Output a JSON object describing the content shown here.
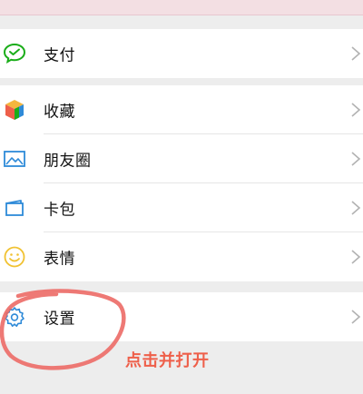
{
  "menu": {
    "pay": {
      "label": "支付",
      "icon": "wechat-pay-icon"
    },
    "favorites": {
      "label": "收藏",
      "icon": "favorites-cube-icon"
    },
    "moments": {
      "label": "朋友圈",
      "icon": "moments-photo-icon"
    },
    "cards": {
      "label": "卡包",
      "icon": "card-wallet-icon"
    },
    "stickers": {
      "label": "表情",
      "icon": "smiley-face-icon"
    },
    "settings": {
      "label": "设置",
      "icon": "gear-icon"
    }
  },
  "annotation": {
    "text": "点击并打开",
    "color": "#ee5f4a"
  },
  "colors": {
    "pay_icon": "#1aad19",
    "moments_icon": "#2e8ad8",
    "cards_icon": "#2e8ad8",
    "stickers_icon": "#f1c232",
    "settings_icon": "#2e8ad8",
    "chevron": "#b2b2b2"
  }
}
